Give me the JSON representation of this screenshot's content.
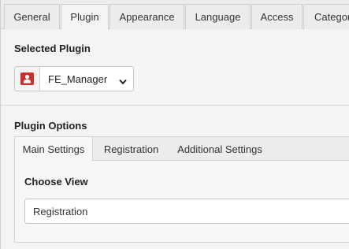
{
  "top_tabs": [
    "General",
    "Plugin",
    "Appearance",
    "Language",
    "Access",
    "Categor"
  ],
  "active_top_tab": "Plugin",
  "selected_plugin": {
    "heading": "Selected Plugin",
    "value": "FE_Manager",
    "icon": "user-icon"
  },
  "plugin_options": {
    "heading": "Plugin Options",
    "tabs": [
      "Main Settings",
      "Registration",
      "Additional Settings"
    ],
    "active_tab": "Main Settings",
    "choose_view": {
      "label": "Choose View",
      "value": "Registration"
    }
  },
  "colors": {
    "icon_red": "#c9302c",
    "tab_bar": "#ececec",
    "panel_bg": "#f4f4f4"
  }
}
